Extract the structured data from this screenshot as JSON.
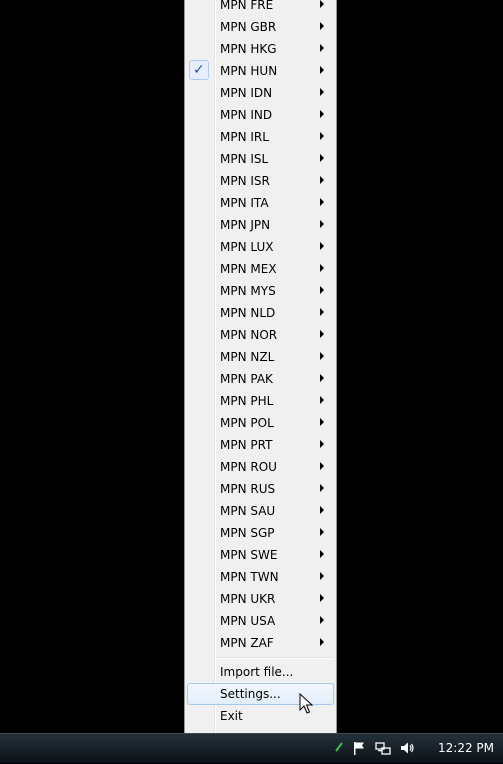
{
  "menu": {
    "items": [
      {
        "label": "MPN FRE",
        "checked": false
      },
      {
        "label": "MPN GBR",
        "checked": false
      },
      {
        "label": "MPN HKG",
        "checked": false
      },
      {
        "label": "MPN HUN",
        "checked": true
      },
      {
        "label": "MPN IDN",
        "checked": false
      },
      {
        "label": "MPN IND",
        "checked": false
      },
      {
        "label": "MPN IRL",
        "checked": false
      },
      {
        "label": "MPN ISL",
        "checked": false
      },
      {
        "label": "MPN ISR",
        "checked": false
      },
      {
        "label": "MPN ITA",
        "checked": false
      },
      {
        "label": "MPN JPN",
        "checked": false
      },
      {
        "label": "MPN LUX",
        "checked": false
      },
      {
        "label": "MPN MEX",
        "checked": false
      },
      {
        "label": "MPN MYS",
        "checked": false
      },
      {
        "label": "MPN NLD",
        "checked": false
      },
      {
        "label": "MPN NOR",
        "checked": false
      },
      {
        "label": "MPN NZL",
        "checked": false
      },
      {
        "label": "MPN PAK",
        "checked": false
      },
      {
        "label": "MPN PHL",
        "checked": false
      },
      {
        "label": "MPN POL",
        "checked": false
      },
      {
        "label": "MPN PRT",
        "checked": false
      },
      {
        "label": "MPN ROU",
        "checked": false
      },
      {
        "label": "MPN RUS",
        "checked": false
      },
      {
        "label": "MPN SAU",
        "checked": false
      },
      {
        "label": "MPN SGP",
        "checked": false
      },
      {
        "label": "MPN SWE",
        "checked": false
      },
      {
        "label": "MPN TWN",
        "checked": false
      },
      {
        "label": "MPN UKR",
        "checked": false
      },
      {
        "label": "MPN USA",
        "checked": false
      },
      {
        "label": "MPN ZAF",
        "checked": false
      }
    ],
    "check_glyph": "✓",
    "actions": {
      "import_file": "Import file...",
      "settings": "Settings...",
      "exit": "Exit"
    },
    "hovered_action": "settings"
  },
  "taskbar": {
    "clock": "12:22 PM",
    "tray_icons": [
      "action-center-flag-icon",
      "network-icon",
      "volume-icon"
    ]
  },
  "colors": {
    "menu_bg": "#f0f0f0",
    "hover_border": "#a8c9ee",
    "check_color": "#2453a8",
    "desktop_bg": "#000000"
  }
}
